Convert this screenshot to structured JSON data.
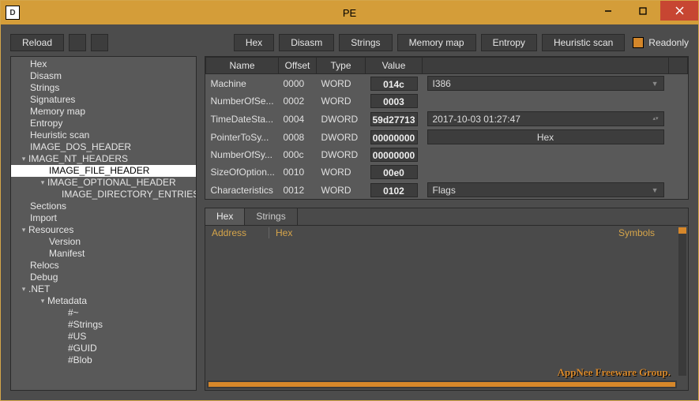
{
  "window": {
    "title": "PE"
  },
  "toolbar": {
    "reload": "Reload",
    "hex": "Hex",
    "disasm": "Disasm",
    "strings": "Strings",
    "memmap": "Memory map",
    "entropy": "Entropy",
    "heuristic": "Heuristic scan",
    "readonly": "Readonly"
  },
  "tree": [
    {
      "label": "Hex",
      "indent": 24
    },
    {
      "label": "Disasm",
      "indent": 24
    },
    {
      "label": "Strings",
      "indent": 24
    },
    {
      "label": "Signatures",
      "indent": 24
    },
    {
      "label": "Memory map",
      "indent": 24
    },
    {
      "label": "Entropy",
      "indent": 24
    },
    {
      "label": "Heuristic scan",
      "indent": 24
    },
    {
      "label": "IMAGE_DOS_HEADER",
      "indent": 24
    },
    {
      "label": "IMAGE_NT_HEADERS",
      "indent": 24,
      "arrow": "▾"
    },
    {
      "label": "IMAGE_FILE_HEADER",
      "indent": 48,
      "selected": true
    },
    {
      "label": "IMAGE_OPTIONAL_HEADER",
      "indent": 48,
      "arrow": "▾"
    },
    {
      "label": "IMAGE_DIRECTORY_ENTRIES",
      "indent": 64
    },
    {
      "label": "Sections",
      "indent": 24
    },
    {
      "label": "Import",
      "indent": 24
    },
    {
      "label": "Resources",
      "indent": 24,
      "arrow": "▾"
    },
    {
      "label": "Version",
      "indent": 48
    },
    {
      "label": "Manifest",
      "indent": 48
    },
    {
      "label": "Relocs",
      "indent": 24
    },
    {
      "label": "Debug",
      "indent": 24
    },
    {
      "label": ".NET",
      "indent": 24,
      "arrow": "▾"
    },
    {
      "label": "Metadata",
      "indent": 48,
      "arrow": "▾"
    },
    {
      "label": "#~",
      "indent": 72
    },
    {
      "label": "#Strings",
      "indent": 72
    },
    {
      "label": "#US",
      "indent": 72
    },
    {
      "label": "#GUID",
      "indent": 72
    },
    {
      "label": "#Blob",
      "indent": 72
    }
  ],
  "table": {
    "headers": {
      "name": "Name",
      "offset": "Offset",
      "type": "Type",
      "value": "Value"
    },
    "rows": [
      {
        "name": "Machine",
        "offset": "0000",
        "type": "WORD",
        "value": "014c",
        "extra": "I386",
        "extraMode": "dropdown"
      },
      {
        "name": "NumberOfSe...",
        "offset": "0002",
        "type": "WORD",
        "value": "0003"
      },
      {
        "name": "TimeDateSta...",
        "offset": "0004",
        "type": "DWORD",
        "value": "59d27713",
        "extra": "2017-10-03 01:27:47",
        "extraMode": "datetime"
      },
      {
        "name": "PointerToSy...",
        "offset": "0008",
        "type": "DWORD",
        "value": "00000000",
        "extra": "Hex",
        "extraMode": "button"
      },
      {
        "name": "NumberOfSy...",
        "offset": "000c",
        "type": "DWORD",
        "value": "00000000"
      },
      {
        "name": "SizeOfOption...",
        "offset": "0010",
        "type": "WORD",
        "value": "00e0"
      },
      {
        "name": "Characteristics",
        "offset": "0012",
        "type": "WORD",
        "value": "0102",
        "extra": "Flags",
        "extraMode": "dropdown"
      }
    ]
  },
  "hexView": {
    "tabs": {
      "hex": "Hex",
      "strings": "Strings"
    },
    "cols": {
      "addr": "Address",
      "hex": "Hex",
      "sym": "Symbols"
    },
    "watermark": "AppNee Freeware Group."
  }
}
